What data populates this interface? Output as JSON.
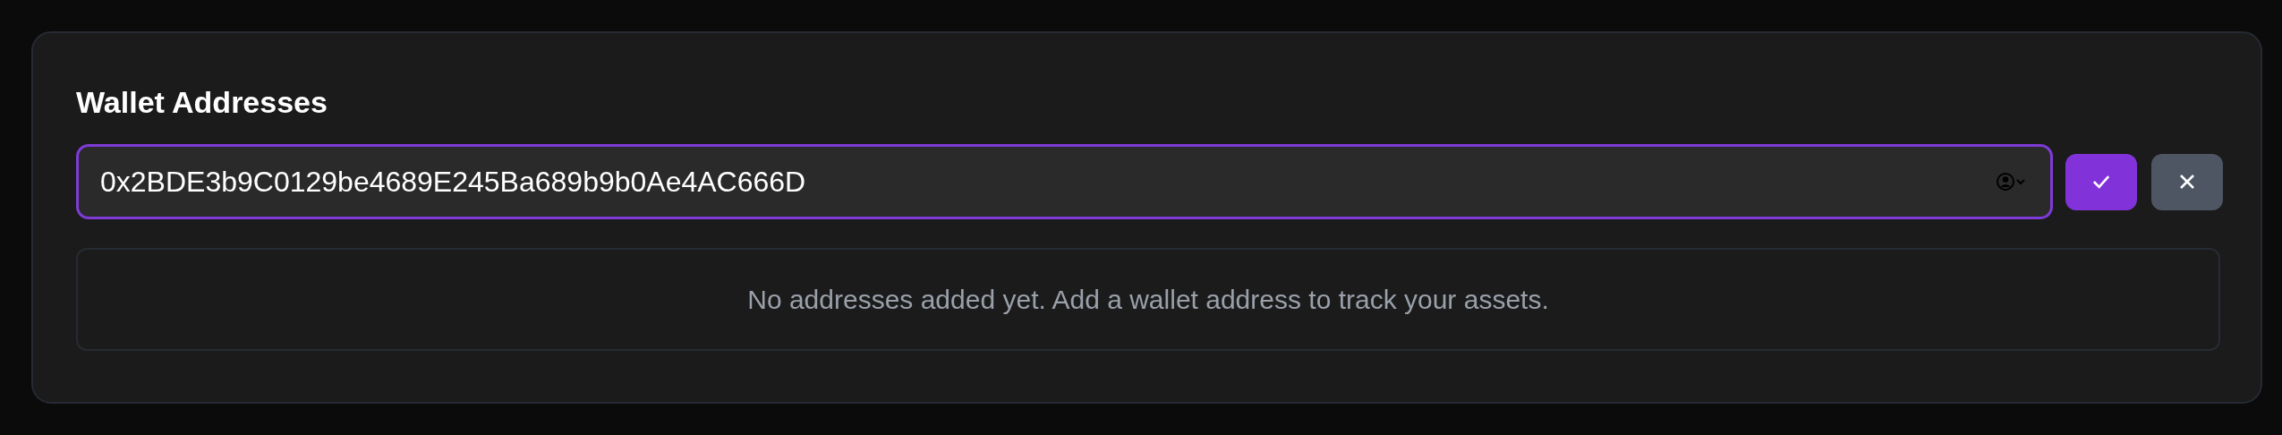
{
  "card": {
    "title": "Wallet Addresses",
    "address_input": {
      "value": "0x2BDE3b9C0129be4689E245Ba689b9b0Ae4AC666D",
      "focused": true
    },
    "buttons": [
      {
        "kind": "confirm"
      },
      {
        "kind": "cancel"
      }
    ],
    "empty_message": "No addresses added yet. Add a wallet address to track your assets."
  }
}
